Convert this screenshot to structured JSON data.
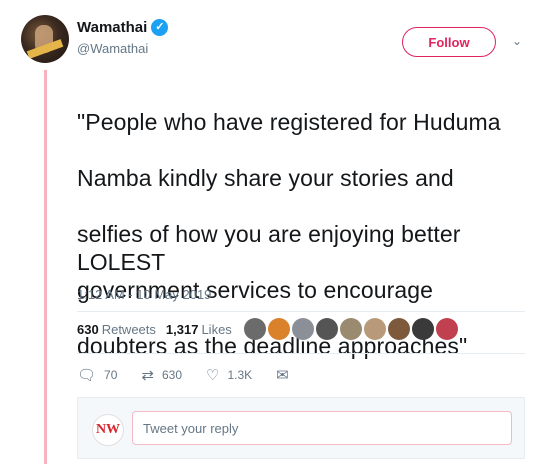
{
  "author": {
    "display_name": "Wamathai",
    "handle": "@Wamathai",
    "verified": true
  },
  "header": {
    "follow_label": "Follow",
    "more_icon": "chevron-down-icon"
  },
  "tweet": {
    "lines": [
      "\"People who have registered for Huduma",
      "Namba kindly share your stories and",
      "selfies of how you are enjoying better",
      "government services to encourage",
      "doubters as the deadline approaches\""
    ],
    "footer_text": "LOLEST",
    "timestamp": "1:12 AM - 10 May 2019"
  },
  "stats": {
    "retweets_count": "630",
    "retweets_label": "Retweets",
    "likes_count": "1,317",
    "likes_label": "Likes"
  },
  "likers": [
    "#6b6b6b",
    "#d9822b",
    "#8a8f98",
    "#555555",
    "#9a8a70",
    "#b89a7a",
    "#7d5a3c",
    "#3a3a3a",
    "#c04050"
  ],
  "actions": {
    "replies": "70",
    "retweets": "630",
    "likes": "1.3K"
  },
  "reply": {
    "avatar_text": "NW",
    "placeholder": "Tweet your reply"
  },
  "colors": {
    "accent": "#e0245e",
    "verified": "#1da1f2",
    "muted": "#657786",
    "thread_line": "#f7b2bd"
  }
}
